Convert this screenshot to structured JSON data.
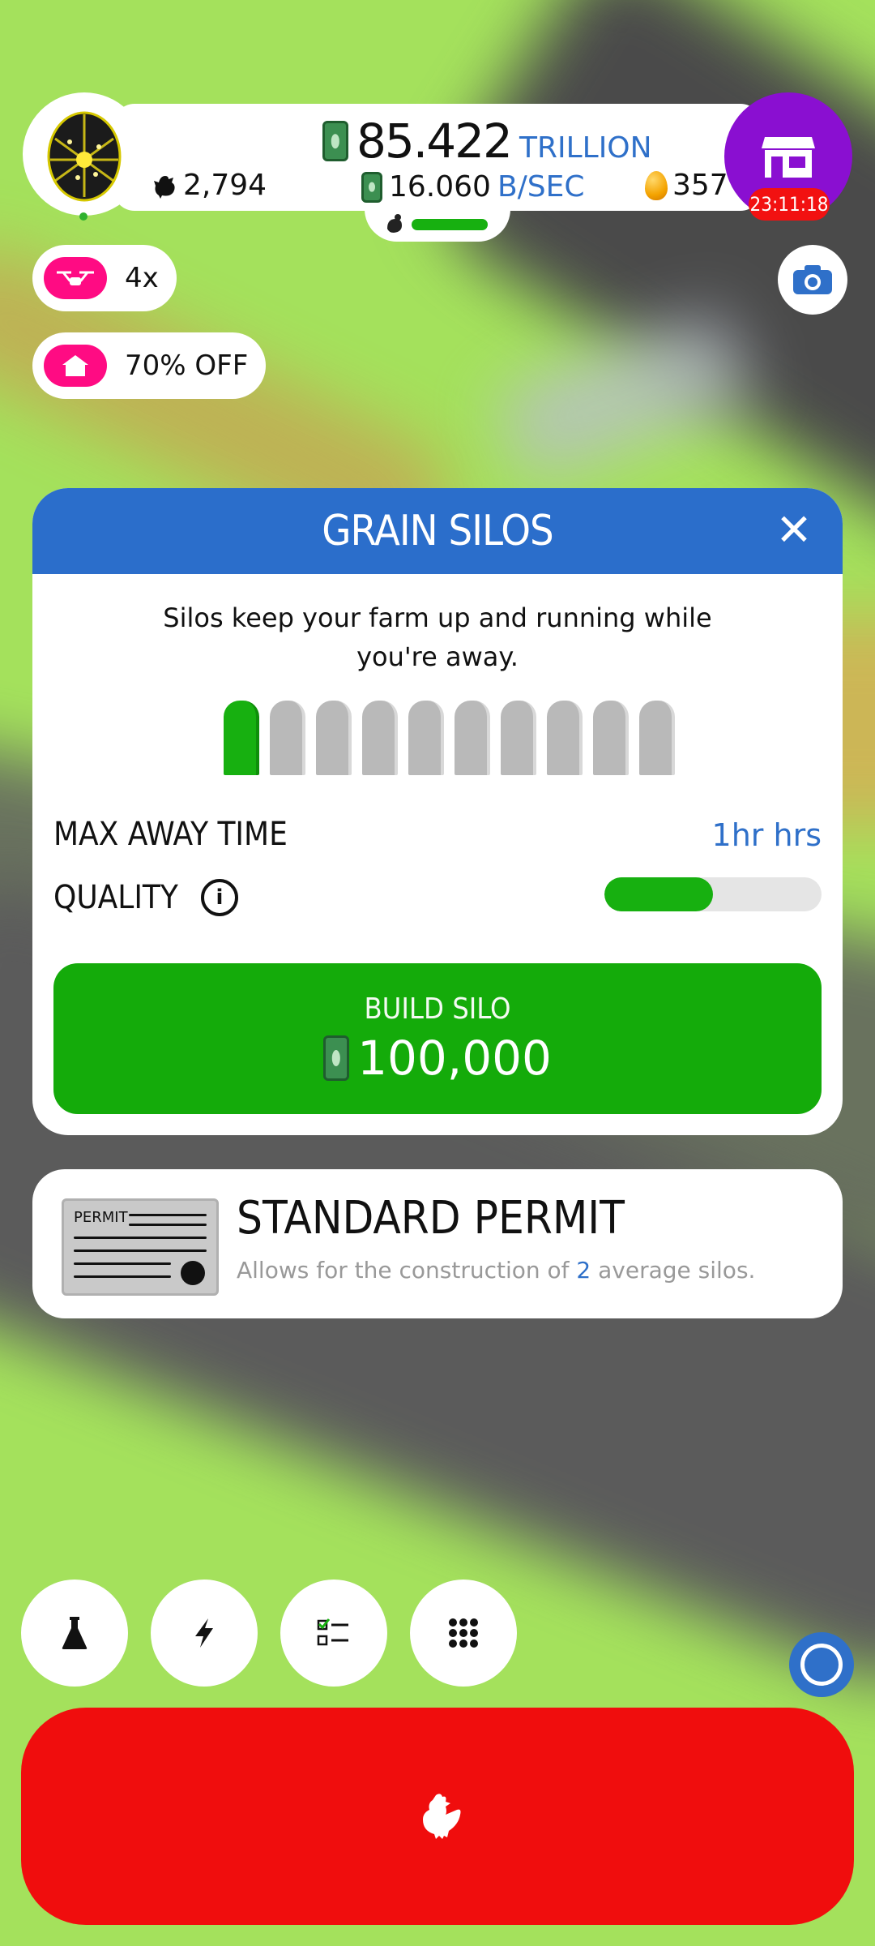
{
  "hud": {
    "money_value": "85.422",
    "money_unit": "TRILLION",
    "rate_value": "16.060",
    "rate_unit": "B/SEC",
    "chicken_count": "2,794",
    "golden_eggs": "357",
    "shop_timer": "23:11:18",
    "progress_fraction": 1.0
  },
  "boosts": {
    "drone_label": "4x",
    "sale_label": "70% OFF"
  },
  "dialog": {
    "title": "GRAIN SILOS",
    "description_line1": "Silos keep your farm up and running while",
    "description_line2": "you're away.",
    "silos_owned": 1,
    "silos_total": 10,
    "max_away_label": "MAX AWAY TIME",
    "max_away_value": "1hr hrs",
    "quality_label": "QUALITY",
    "quality_fraction": 0.5,
    "build_label": "BUILD SILO",
    "build_price": "100,000"
  },
  "permit": {
    "badge": "PERMIT",
    "title": "STANDARD PERMIT",
    "desc_pre": "Allows for the construction of ",
    "desc_count": "2",
    "desc_post": " average silos."
  },
  "colors": {
    "background": "#a4e15c",
    "dialog_header": "#2b6ecb",
    "accent_green": "#14ab0a",
    "accent_blue": "#2f70c9",
    "hatch_red": "#f00d0d",
    "shop_purple": "#8a0fd1",
    "boost_pink": "#ff0b83"
  },
  "icons": {
    "research": "flask-icon",
    "boosts": "lightning-icon",
    "missions": "checklist-icon",
    "menu": "grid-icon",
    "hatch": "chicken-icon",
    "camera": "camera-icon",
    "shop": "shop-icon"
  }
}
